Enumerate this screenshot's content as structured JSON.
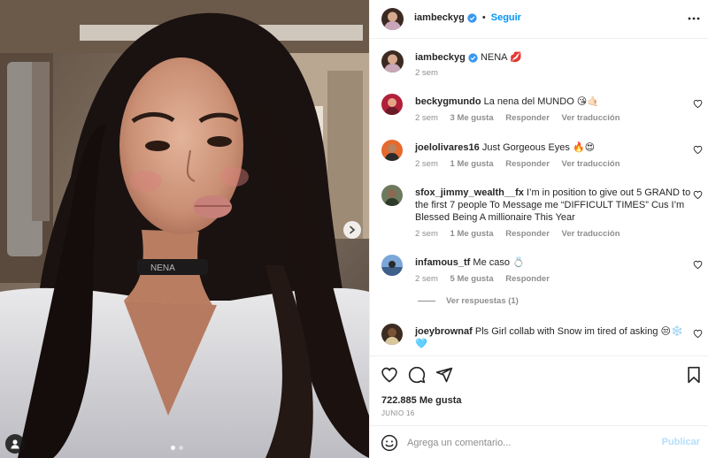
{
  "post": {
    "author": "iambeckyg",
    "follow_label": "Seguir",
    "more_icon": "more-horizontal-icon"
  },
  "caption": {
    "username": "iambeckyg",
    "text": "NENA 💋",
    "time": "2 sem"
  },
  "comments": [
    {
      "username": "beckygmundo",
      "text": "La nena del MUNDO 😘🤙🏻",
      "time": "2 sem",
      "likes": "3 Me gusta",
      "reply": "Responder",
      "translate": "Ver traducción"
    },
    {
      "username": "joelolivares16",
      "text": "Just Gorgeous Eyes 🔥😍",
      "time": "2 sem",
      "likes": "1 Me gusta",
      "reply": "Responder",
      "translate": "Ver traducción"
    },
    {
      "username": "sfox_jimmy_wealth__fx",
      "text": "I’m in position to give out 5 GRAND to the first 7 people To Message me “DIFFICULT TIMES” Cus I’m Blessed Being A millionaire This Year",
      "time": "2 sem",
      "likes": "1 Me gusta",
      "reply": "Responder",
      "translate": "Ver traducción"
    },
    {
      "username": "infamous_tf",
      "text": "Me caso 💍",
      "time": "2 sem",
      "likes": "5 Me gusta",
      "reply": "Responder"
    },
    {
      "username": "joeybrownaf",
      "text": "Pls Girl collab with Snow im tired of asking 😒❄️🩵"
    }
  ],
  "replies_label": "Ver respuestas (1)",
  "likes_count": "722.885 Me gusta",
  "date": "JUNIO 16",
  "add_comment": {
    "placeholder": "Agrega un comentario...",
    "publish_label": "Publicar"
  },
  "colors": {
    "accent": "#0095f6",
    "verified": "#3897f0",
    "publish_disabled": "#b2dffc",
    "muted": "#8e8e8e"
  }
}
